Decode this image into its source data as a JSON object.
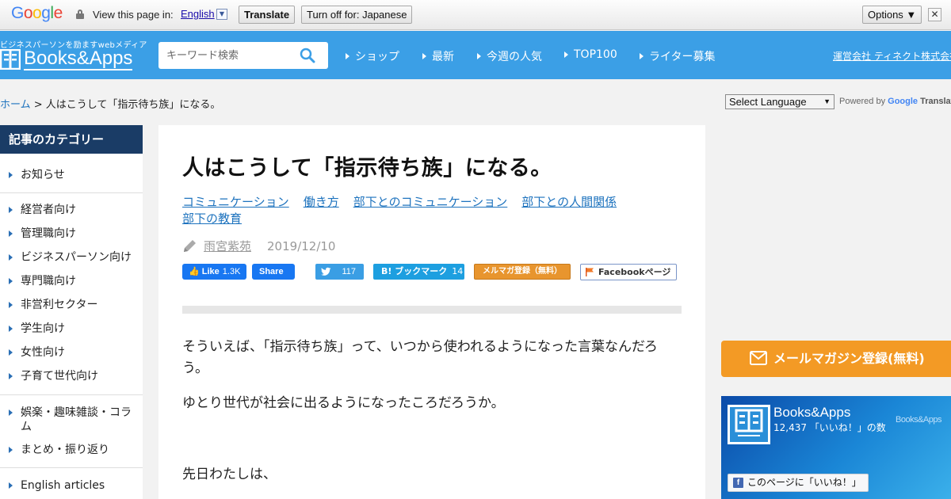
{
  "translate_bar": {
    "logo": "Google",
    "view_text": "View this page in:",
    "language": "English",
    "translate_label": "Translate",
    "turn_off_label": "Turn off for: Japanese",
    "options_label": "Options ▼",
    "close_label": "✕"
  },
  "header": {
    "tagline": "ビジネスパーソンを励ますwebメディア",
    "logo_text": "Books&Apps",
    "search_placeholder": "キーワード検索",
    "nav": [
      "ショップ",
      "最新",
      "今週の人気",
      "TOP100",
      "ライター募集"
    ],
    "company_link": "運営会社 ティネクト株式会社"
  },
  "breadcrumb": {
    "home": "ホーム",
    "separator": " > ",
    "current": "人はこうして「指示待ち族」になる。"
  },
  "translate_widget": {
    "select_label": "Select Language",
    "powered_by": "Powered by",
    "google": "Google",
    "translate": "Translate"
  },
  "sidebar": {
    "heading": "記事のカテゴリー",
    "items": [
      "お知らせ",
      "経営者向け",
      "管理職向け",
      "ビジネスパーソン向け",
      "専門職向け",
      "非営利セクター",
      "学生向け",
      "女性向け",
      "子育て世代向け",
      "娯楽・趣味雑談・コラム",
      "まとめ・振り返り",
      "English articles"
    ]
  },
  "article": {
    "title": "人はこうして「指示待ち族」になる。",
    "tags": [
      "コミュニケーション",
      "働き方",
      "部下とのコミュニケーション",
      "部下との人間関係",
      "部下の教育"
    ],
    "author": "雨宮紫苑",
    "date": "2019/12/10",
    "share": {
      "fb_like": "Like",
      "fb_like_count": "1.3K",
      "fb_share": "Share",
      "tweet_count": "117",
      "hatena_label": "B! ブックマーク",
      "hatena_count": "14",
      "mailmag": "メルマガ登録（無料）",
      "facebook_page": "Facebookページ"
    },
    "paragraphs": [
      "そういえば、「指示待ち族」って、いつから使われるようになった言葉なんだろう。",
      "ゆとり世代が社会に出るようになったころだろうか。",
      "先日わたしは、"
    ]
  },
  "right": {
    "mail_button": "メールマガジン登録(無料)",
    "fb_widget": {
      "name": "Books&Apps",
      "likes": "12,437 「いいね！」の数",
      "brand": "Books&Apps",
      "like_button": "このページに「いいね！」"
    }
  },
  "colors": {
    "header_blue": "#3b9fe6",
    "sidebar_head": "#1a3c66",
    "link": "#1e73be",
    "mail_orange": "#f39a25"
  }
}
